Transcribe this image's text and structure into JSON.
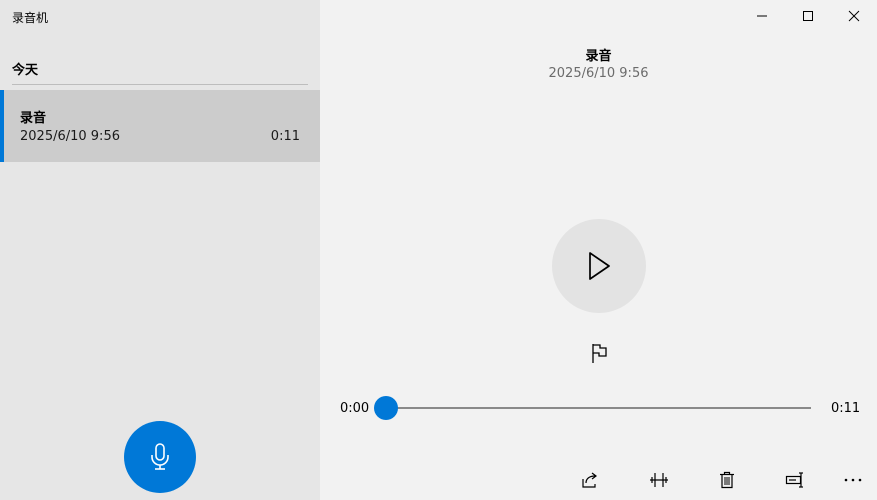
{
  "app": {
    "title": "录音机"
  },
  "sidebar": {
    "group_header": "今天",
    "items": [
      {
        "name": "录音",
        "date": "2025/6/10 9:56",
        "duration": "0:11"
      }
    ]
  },
  "player": {
    "title": "录音",
    "date": "2025/6/10 9:56",
    "position": "0:00",
    "duration": "0:11",
    "progress_fraction": 0.0
  },
  "colors": {
    "accent": "#0078d7",
    "sidebar_bg": "#e6e6e6",
    "selected_bg": "#cccccc",
    "main_bg": "#f2f2f2"
  },
  "icons": {
    "minimize": "minimize-icon",
    "maximize": "maximize-icon",
    "close": "close-icon",
    "play": "play-icon",
    "flag": "flag-icon",
    "mic": "microphone-icon",
    "share": "share-icon",
    "trim": "trim-icon",
    "delete": "delete-icon",
    "rename": "rename-icon",
    "more": "more-icon"
  }
}
